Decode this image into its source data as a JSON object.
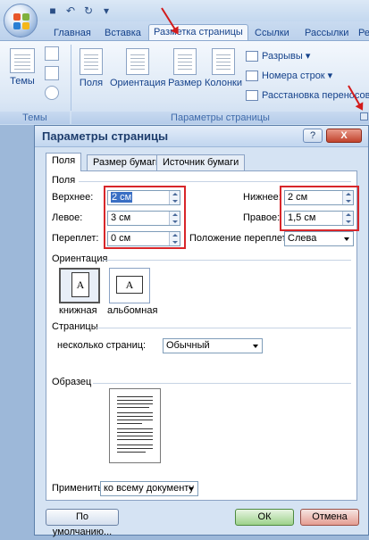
{
  "ribbon": {
    "tabs": [
      "Главная",
      "Вставка",
      "Разметка страницы",
      "Ссылки",
      "Рассылки",
      "Ре"
    ],
    "active_tab": "Разметка страницы",
    "themes": {
      "label": "Темы",
      "caption": "Темы"
    },
    "page_setup": {
      "buttons": [
        "Поля",
        "Ориентация",
        "Размер",
        "Колонки"
      ],
      "small_items": [
        "Разрывы",
        "Номера строк",
        "Расстановка переносов"
      ],
      "caption": "Параметры страницы"
    }
  },
  "dialog": {
    "title": "Параметры страницы",
    "help_glyph": "?",
    "close_glyph": "X",
    "tabs": [
      "Поля",
      "Размер бумаги",
      "Источник бумаги"
    ],
    "active_tab": "Поля",
    "margins": {
      "section": "Поля",
      "top": {
        "label": "Верхнее:",
        "value": "2 см"
      },
      "bottom": {
        "label": "Нижнее:",
        "value": "2 см"
      },
      "left": {
        "label": "Левое:",
        "value": "3 см"
      },
      "right": {
        "label": "Правое:",
        "value": "1,5 см"
      },
      "gutter": {
        "label": "Переплет:",
        "value": "0 см"
      },
      "gutter_pos": {
        "label": "Положение переплета:",
        "value": "Слева"
      }
    },
    "orientation": {
      "section": "Ориентация",
      "portrait": "книжная",
      "landscape": "альбомная",
      "glyph": "A"
    },
    "pages": {
      "section": "Страницы",
      "label": "несколько страниц:",
      "value": "Обычный"
    },
    "preview": {
      "section": "Образец"
    },
    "apply": {
      "label": "Применить:",
      "value": "ко всему документу"
    },
    "buttons": {
      "default": "По умолчанию...",
      "ok": "ОК",
      "cancel": "Отмена"
    }
  },
  "colors": {
    "annotation": "#d8262a",
    "ribbon_text": "#15428b"
  }
}
